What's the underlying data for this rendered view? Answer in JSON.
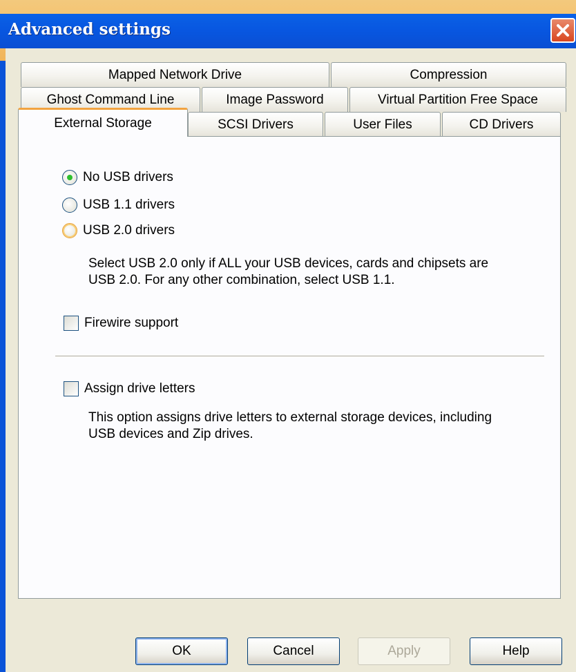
{
  "window": {
    "title": "Advanced settings",
    "close_icon": "close-icon"
  },
  "tabs": {
    "row1": [
      "Mapped Network Drive",
      "Compression"
    ],
    "row2": [
      "Ghost Command Line",
      "Image Password",
      "Virtual Partition Free Space"
    ],
    "row3": [
      "External Storage",
      "SCSI Drivers",
      "User Files",
      "CD Drivers"
    ],
    "active": "External Storage"
  },
  "usb": {
    "options": [
      "No USB drivers",
      "USB 1.1 drivers",
      "USB 2.0 drivers"
    ],
    "selected": "No USB drivers",
    "note_line1": "Select USB 2.0 only if ALL your USB devices, cards and chipsets are",
    "note_line2": "USB 2.0. For any other combination, select USB 1.1."
  },
  "firewire": {
    "label": "Firewire support",
    "checked": false
  },
  "drive_letters": {
    "label": "Assign drive letters",
    "checked": false,
    "note_line1": "This option assigns drive letters to external storage devices, including",
    "note_line2": "USB devices and Zip drives."
  },
  "buttons": {
    "ok": "OK",
    "cancel": "Cancel",
    "apply": "Apply",
    "help": "Help"
  },
  "colors": {
    "titlebar": "#0856e0",
    "window_bg": "#ece9d8",
    "active_tab_accent": "#f2a340",
    "radio_selected": "#2ebf2e",
    "close_button": "#d9461f"
  }
}
